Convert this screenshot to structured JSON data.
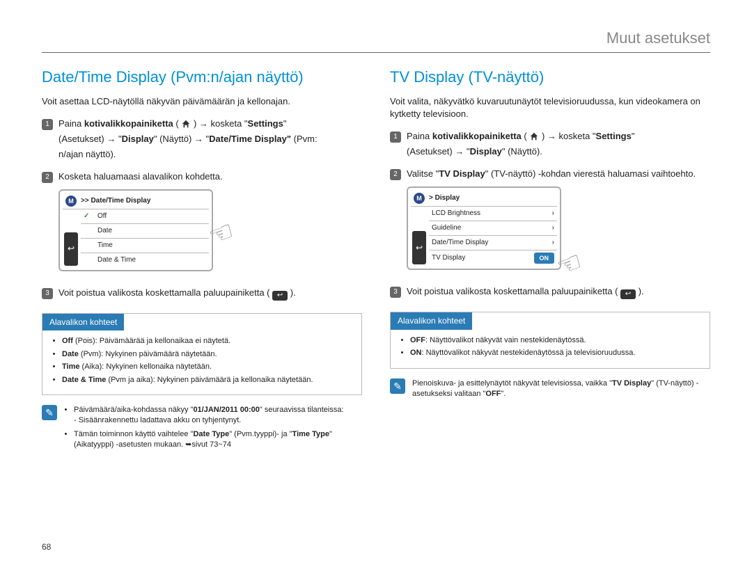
{
  "header": {
    "section": "Muut asetukset"
  },
  "left": {
    "title": "Date/Time Display (Pvm:n/ajan näyttö)",
    "intro": "Voit asettaa LCD-näytöllä näkyvän päivämäärän ja kellonajan.",
    "step1": {
      "num": "1",
      "pre": "Paina ",
      "homeBtn": "kotivalikkopainiketta",
      "mid1": " ( ",
      "mid2": " ) → kosketa \"",
      "settings": "Settings",
      "line2a": "(Asetukset) → \"",
      "display": "Display",
      "line2b": "\" (Näyttö) → \"",
      "dtd": "Date/Time Display\"",
      "line2c": " (Pvm:",
      "line3": "n/ajan näyttö)."
    },
    "step2": {
      "num": "2",
      "text": "Kosketa haluamaasi alavalikon kohdetta."
    },
    "screen1": {
      "breadcrumb": ">> Date/Time Display",
      "items": [
        "Off",
        "Date",
        "Time",
        "Date & Time"
      ]
    },
    "step3": {
      "num": "3",
      "pre": "Voit poistua valikosta koskettamalla paluupainiketta ( ",
      "post": " )."
    },
    "submenu": {
      "title": "Alavalikon kohteet",
      "items": [
        {
          "bold": "Off",
          "rest": " (Pois): Päivämäärää ja kellonaikaa ei näytetä."
        },
        {
          "bold": "Date",
          "rest": " (Pvm): Nykyinen päivämäärä näytetään."
        },
        {
          "bold": "Time",
          "rest": " (Aika): Nykyinen kellonaika näytetään."
        },
        {
          "bold": "Date & Time",
          "rest": " (Pvm ja aika): Nykyinen päivämäärä ja kellonaika näytetään."
        }
      ]
    },
    "note": {
      "li1a": "Päivämäärä/aika-kohdassa näkyy \"",
      "li1date": "01/JAN/2011 00:00",
      "li1b": "\" seuraavissa tilanteissa:",
      "li1sub": "- Sisäänrakennettu ladattava akku on tyhjentynyt.",
      "li2a": "Tämän toiminnon käyttö vaihtelee \"",
      "li2dt": "Date Type",
      "li2b": "\" (Pvm.tyyppi)- ja \"",
      "li2tt": "Time Type",
      "li2c": "\" (Aikatyyppi) -asetusten mukaan. ➥sivut 73~74"
    }
  },
  "right": {
    "title": "TV Display (TV-näyttö)",
    "intro": "Voit valita, näkyvätkö kuvaruutunäytöt televisioruudussa, kun videokamera on kytketty televisioon.",
    "step1": {
      "num": "1",
      "pre": "Paina ",
      "homeBtn": "kotivalikkopainiketta",
      "mid1": " ( ",
      "mid2": " ) → kosketa \"",
      "settings": "Settings",
      "line2a": "(Asetukset) → \"",
      "display": "Display",
      "line2b": "\" (Näyttö)."
    },
    "step2": {
      "num": "2",
      "pre": "Valitse \"",
      "tvd": "TV Display",
      "post": "\" (TV-näyttö) -kohdan vierestä haluamasi vaihtoehto."
    },
    "screen2": {
      "breadcrumb": "> Display",
      "items": [
        "LCD Brightness",
        "Guideline",
        "Date/Time Display",
        "TV Display"
      ],
      "toggle": "ON"
    },
    "step3": {
      "num": "3",
      "pre": "Voit poistua valikosta koskettamalla paluupainiketta ( ",
      "post": " )."
    },
    "submenu": {
      "title": "Alavalikon kohteet",
      "items": [
        {
          "bold": "OFF",
          "rest": ": Näyttövalikot näkyvät vain nestekidenäytössä."
        },
        {
          "bold": "ON",
          "rest": ": Näyttövalikot näkyvät nestekidenäytössä ja televisioruudussa."
        }
      ]
    },
    "note": {
      "pre": "Pienoiskuva- ja esittelynäytöt näkyvät televisiossa, vaikka \"",
      "tvd": "TV Display",
      "mid": "\" (TV-näyttö) -asetukseksi valitaan \"",
      "off": "OFF",
      "post": "\"."
    }
  },
  "page": "68"
}
